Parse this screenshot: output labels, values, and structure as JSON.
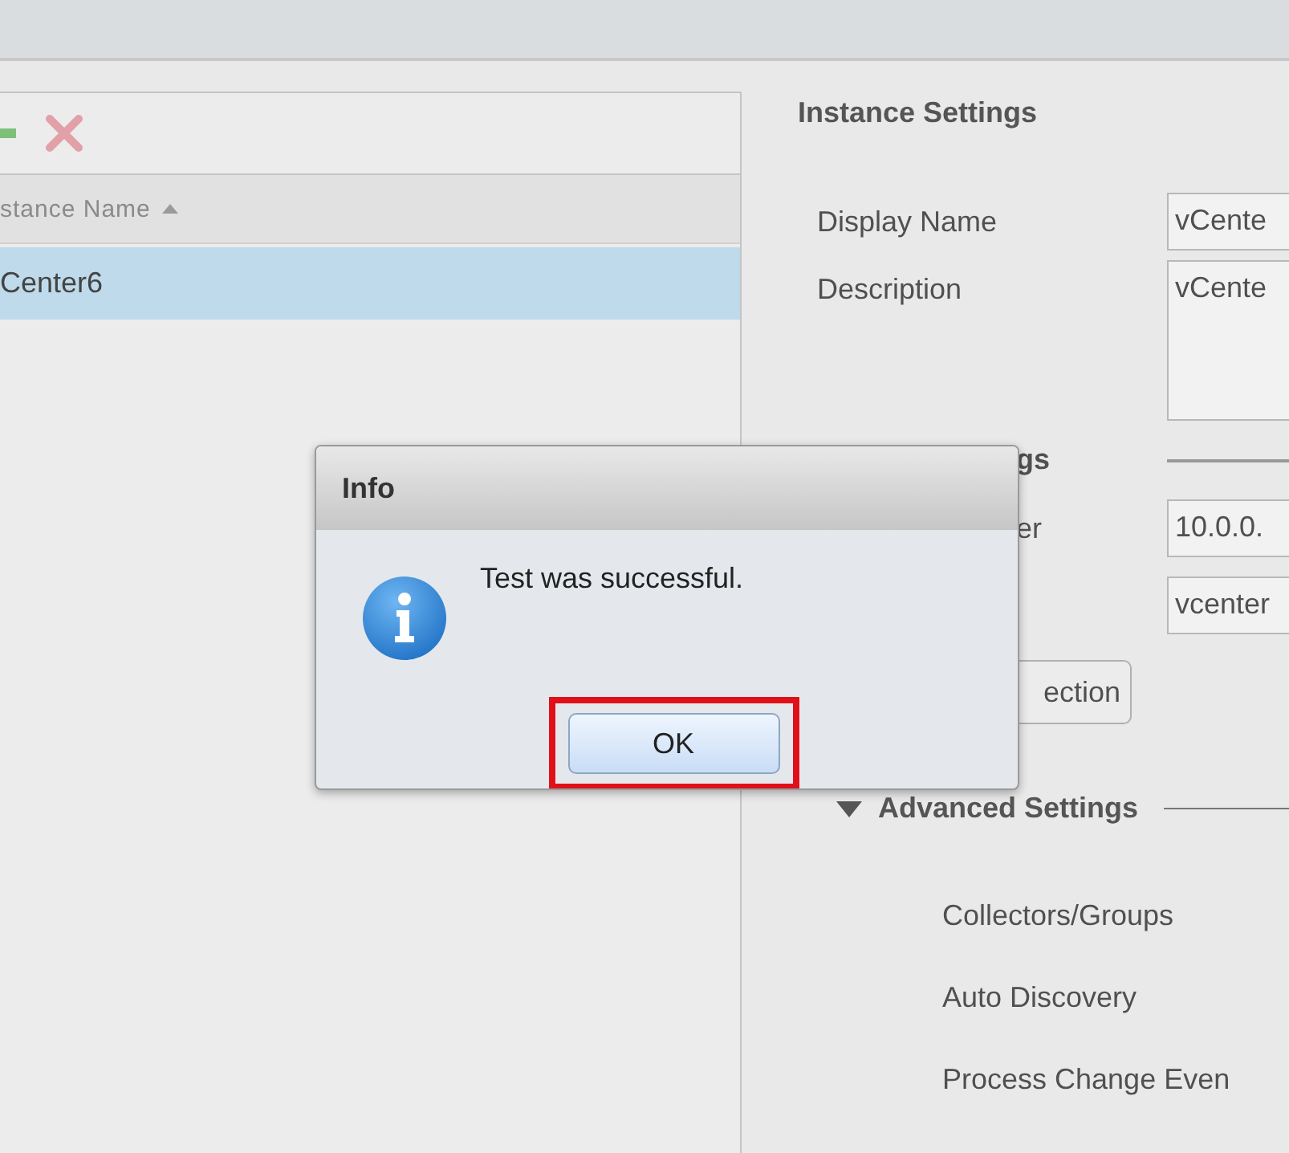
{
  "table": {
    "columns": [
      {
        "label": "stance Name",
        "sorted": true
      }
    ],
    "rows": [
      {
        "cells": [
          "Center6"
        ],
        "selected": true
      }
    ]
  },
  "instance_settings": {
    "title": "Instance Settings",
    "fields": [
      {
        "label": "Display Name",
        "value": "vCente",
        "kind": "input"
      },
      {
        "label": "Description",
        "value": "vCente",
        "kind": "textarea"
      }
    ]
  },
  "connection_settings": {
    "title": "gs",
    "fields": [
      {
        "label": "er",
        "value": "10.0.0.",
        "kind": "input"
      },
      {
        "value": "vcenter",
        "kind": "input"
      }
    ],
    "button": "ection"
  },
  "advanced_settings": {
    "title": "Advanced Settings",
    "expanded": true,
    "items": [
      "Collectors/Groups",
      "Auto Discovery",
      "Process Change Even"
    ]
  },
  "dialog": {
    "title": "Info",
    "message": "Test was successful.",
    "buttons": [
      {
        "label": "OK",
        "highlighted": true
      }
    ]
  }
}
